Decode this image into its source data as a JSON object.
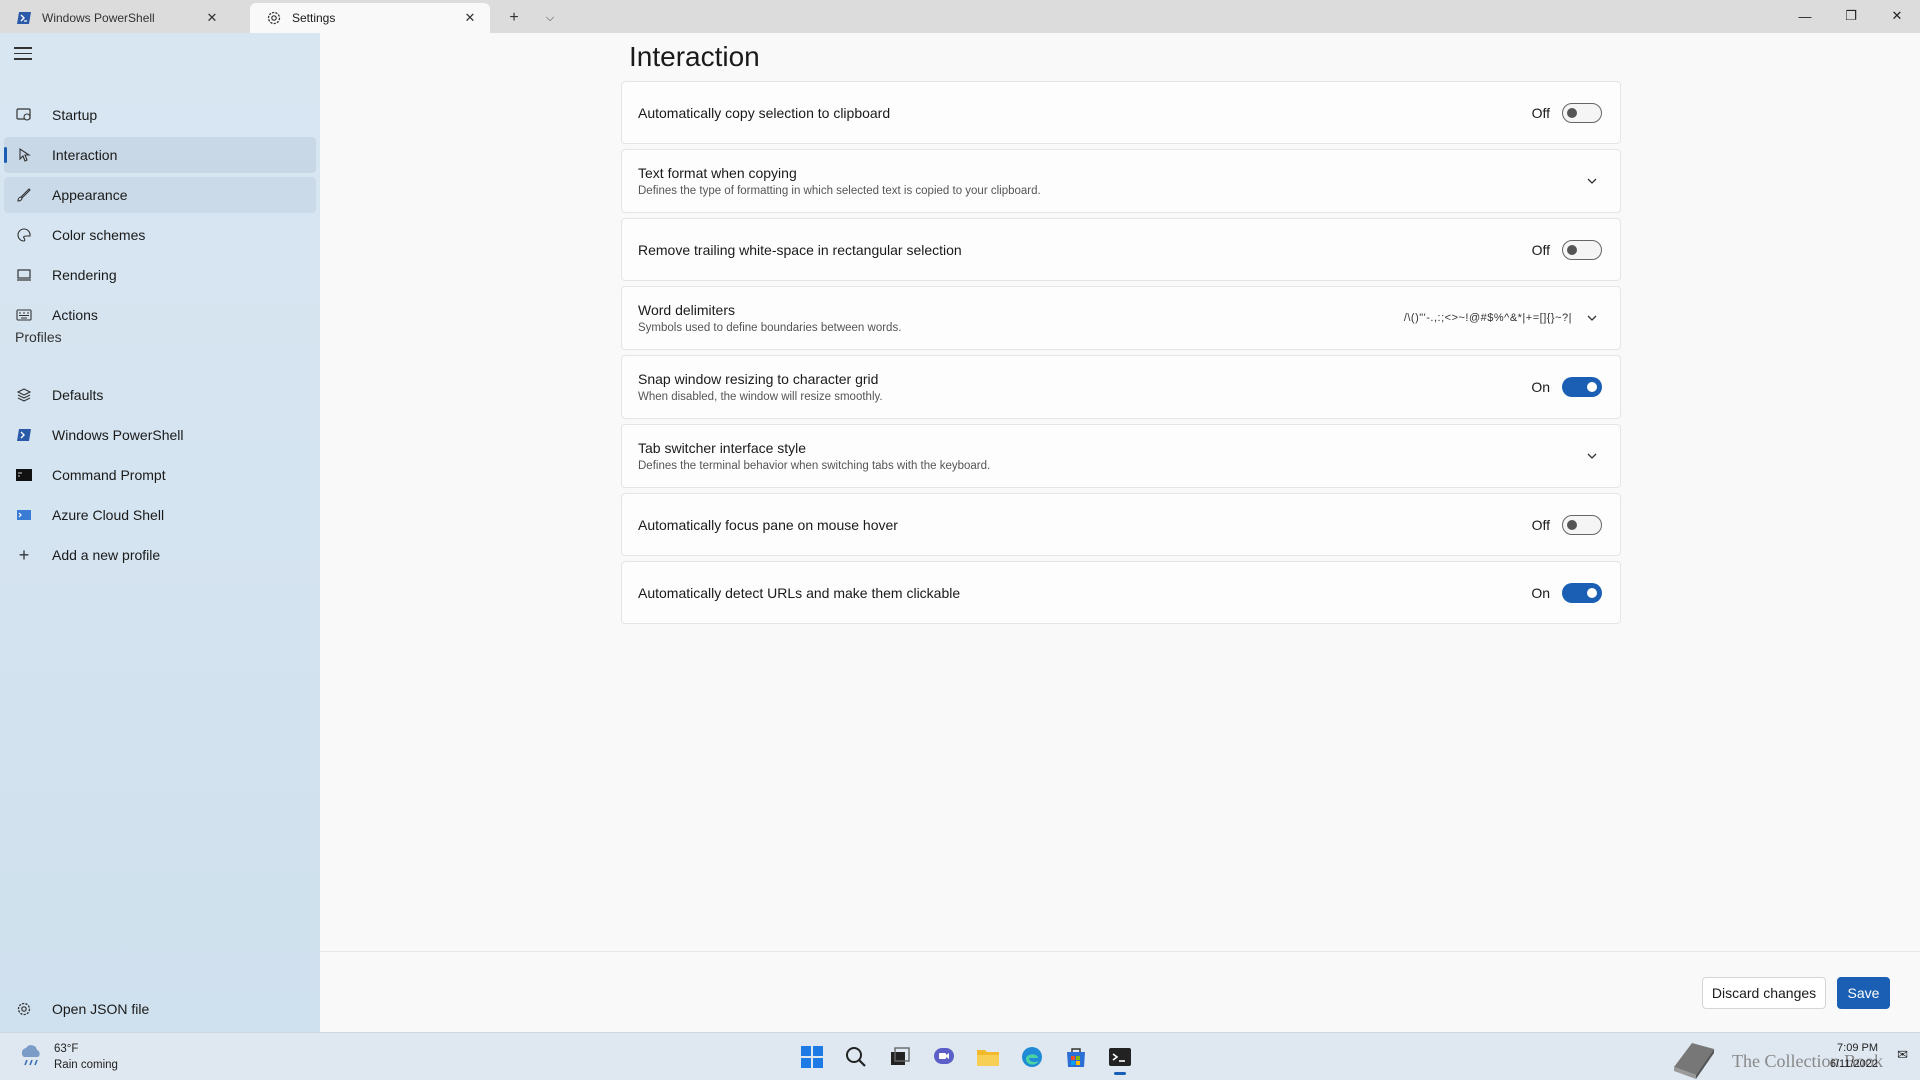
{
  "tabs": [
    {
      "label": "Windows PowerShell",
      "icon": "powershell-icon",
      "active": false
    },
    {
      "label": "Settings",
      "icon": "gear-icon",
      "active": true
    }
  ],
  "sidebar": {
    "items": [
      {
        "label": "Startup",
        "icon": "startup-icon"
      },
      {
        "label": "Interaction",
        "icon": "interaction-icon"
      },
      {
        "label": "Appearance",
        "icon": "brush-icon"
      },
      {
        "label": "Color schemes",
        "icon": "palette-icon"
      },
      {
        "label": "Rendering",
        "icon": "monitor-icon"
      },
      {
        "label": "Actions",
        "icon": "keyboard-icon"
      }
    ],
    "profiles_header": "Profiles",
    "profiles": [
      {
        "label": "Defaults",
        "icon": "layers-icon"
      },
      {
        "label": "Windows PowerShell",
        "icon": "powershell-icon"
      },
      {
        "label": "Command Prompt",
        "icon": "cmd-icon"
      },
      {
        "label": "Azure Cloud Shell",
        "icon": "azure-icon"
      },
      {
        "label": "Add a new profile",
        "icon": "plus-icon"
      }
    ],
    "footer": {
      "label": "Open JSON file",
      "icon": "gear-icon"
    }
  },
  "main": {
    "title": "Interaction",
    "settings": [
      {
        "title": "Automatically copy selection to clipboard",
        "desc": "",
        "control": "toggle",
        "state": "Off"
      },
      {
        "title": "Text format when copying",
        "desc": "Defines the type of formatting in which selected text is copied to your clipboard.",
        "control": "expander"
      },
      {
        "title": "Remove trailing white-space in rectangular selection",
        "desc": "",
        "control": "toggle",
        "state": "Off"
      },
      {
        "title": "Word delimiters",
        "desc": "Symbols used to define boundaries between words.",
        "control": "expander",
        "value": "/\\()\"'-.,:;<>~!@#$%^&*|+=[]{}~?|"
      },
      {
        "title": "Snap window resizing to character grid",
        "desc": "When disabled, the window will resize smoothly.",
        "control": "toggle",
        "state": "On"
      },
      {
        "title": "Tab switcher interface style",
        "desc": "Defines the terminal behavior when switching tabs with the keyboard.",
        "control": "expander"
      },
      {
        "title": "Automatically focus pane on mouse hover",
        "desc": "",
        "control": "toggle",
        "state": "Off"
      },
      {
        "title": "Automatically detect URLs and make them clickable",
        "desc": "",
        "control": "toggle",
        "state": "On"
      }
    ],
    "discard_label": "Discard changes",
    "save_label": "Save"
  },
  "taskbar": {
    "weather_temp": "63°F",
    "weather_desc": "Rain coming",
    "time": "7:09 PM",
    "date": "6/11/2022",
    "watermark": "The Collection Book"
  },
  "colors": {
    "accent": "#1a5fb4",
    "sidebar": "#d8e6f2"
  }
}
